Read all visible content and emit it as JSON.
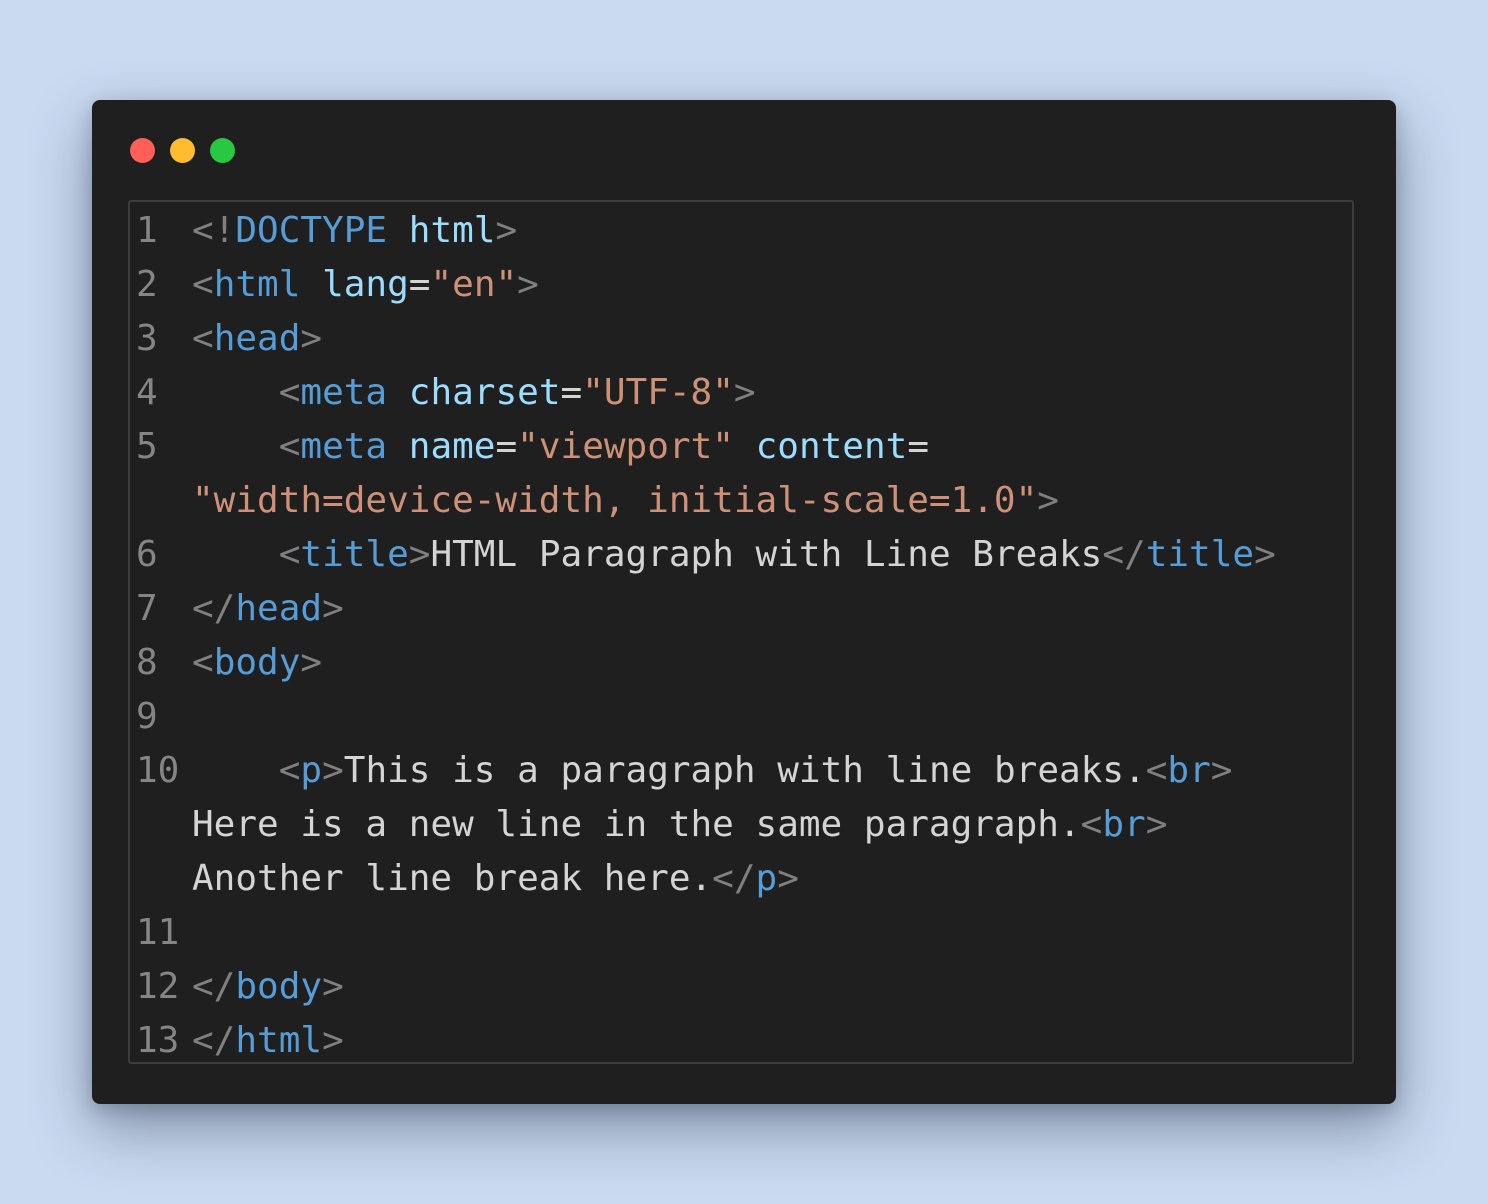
{
  "window": {
    "controls": [
      {
        "name": "close-dot",
        "color": "#ff5f57"
      },
      {
        "name": "minimize-dot",
        "color": "#febc2e"
      },
      {
        "name": "maximize-dot",
        "color": "#28c840"
      }
    ]
  },
  "colors": {
    "punct": "#808080",
    "tag": "#569cd6",
    "attr": "#9cdcfe",
    "string": "#ce9178",
    "text": "#d4d4d4",
    "line_number": "#858585"
  },
  "code": {
    "lines": [
      {
        "num": "1",
        "rows": [
          [
            [
              "punct",
              "<!"
            ],
            [
              "tag",
              "DOCTYPE"
            ],
            [
              "text",
              " "
            ],
            [
              "attr",
              "html"
            ],
            [
              "punct",
              ">"
            ]
          ]
        ]
      },
      {
        "num": "2",
        "rows": [
          [
            [
              "punct",
              "<"
            ],
            [
              "tag",
              "html"
            ],
            [
              "text",
              " "
            ],
            [
              "attr",
              "lang"
            ],
            [
              "text",
              "="
            ],
            [
              "string",
              "\"en\""
            ],
            [
              "punct",
              ">"
            ]
          ]
        ]
      },
      {
        "num": "3",
        "rows": [
          [
            [
              "punct",
              "<"
            ],
            [
              "tag",
              "head"
            ],
            [
              "punct",
              ">"
            ]
          ]
        ]
      },
      {
        "num": "4",
        "rows": [
          [
            [
              "text",
              "    "
            ],
            [
              "punct",
              "<"
            ],
            [
              "tag",
              "meta"
            ],
            [
              "text",
              " "
            ],
            [
              "attr",
              "charset"
            ],
            [
              "text",
              "="
            ],
            [
              "string",
              "\"UTF-8\""
            ],
            [
              "punct",
              ">"
            ]
          ]
        ]
      },
      {
        "num": "5",
        "rows": [
          [
            [
              "text",
              "    "
            ],
            [
              "punct",
              "<"
            ],
            [
              "tag",
              "meta"
            ],
            [
              "text",
              " "
            ],
            [
              "attr",
              "name"
            ],
            [
              "text",
              "="
            ],
            [
              "string",
              "\"viewport\""
            ],
            [
              "text",
              " "
            ],
            [
              "attr",
              "content"
            ],
            [
              "text",
              "="
            ]
          ],
          [
            [
              "string",
              "\"width=device-width, initial-scale=1.0\""
            ],
            [
              "punct",
              ">"
            ]
          ]
        ]
      },
      {
        "num": "6",
        "rows": [
          [
            [
              "text",
              "    "
            ],
            [
              "punct",
              "<"
            ],
            [
              "tag",
              "title"
            ],
            [
              "punct",
              ">"
            ],
            [
              "text",
              "HTML Paragraph with Line Breaks"
            ],
            [
              "punct",
              "</"
            ],
            [
              "tag",
              "title"
            ],
            [
              "punct",
              ">"
            ]
          ]
        ]
      },
      {
        "num": "7",
        "rows": [
          [
            [
              "punct",
              "</"
            ],
            [
              "tag",
              "head"
            ],
            [
              "punct",
              ">"
            ]
          ]
        ]
      },
      {
        "num": "8",
        "rows": [
          [
            [
              "punct",
              "<"
            ],
            [
              "tag",
              "body"
            ],
            [
              "punct",
              ">"
            ]
          ]
        ]
      },
      {
        "num": "9",
        "rows": [
          []
        ]
      },
      {
        "num": "10",
        "rows": [
          [
            [
              "text",
              "    "
            ],
            [
              "punct",
              "<"
            ],
            [
              "tag",
              "p"
            ],
            [
              "punct",
              ">"
            ],
            [
              "text",
              "This is a paragraph with line breaks."
            ],
            [
              "punct",
              "<"
            ],
            [
              "tag",
              "br"
            ],
            [
              "punct",
              ">"
            ]
          ],
          [
            [
              "text",
              "Here is a new line in the same paragraph."
            ],
            [
              "punct",
              "<"
            ],
            [
              "tag",
              "br"
            ],
            [
              "punct",
              ">"
            ]
          ],
          [
            [
              "text",
              "Another line break here."
            ],
            [
              "punct",
              "</"
            ],
            [
              "tag",
              "p"
            ],
            [
              "punct",
              ">"
            ]
          ]
        ]
      },
      {
        "num": "11",
        "rows": [
          []
        ]
      },
      {
        "num": "12",
        "rows": [
          [
            [
              "punct",
              "</"
            ],
            [
              "tag",
              "body"
            ],
            [
              "punct",
              ">"
            ]
          ]
        ]
      },
      {
        "num": "13",
        "rows": [
          [
            [
              "punct",
              "</"
            ],
            [
              "tag",
              "html"
            ],
            [
              "punct",
              ">"
            ]
          ]
        ]
      }
    ]
  }
}
